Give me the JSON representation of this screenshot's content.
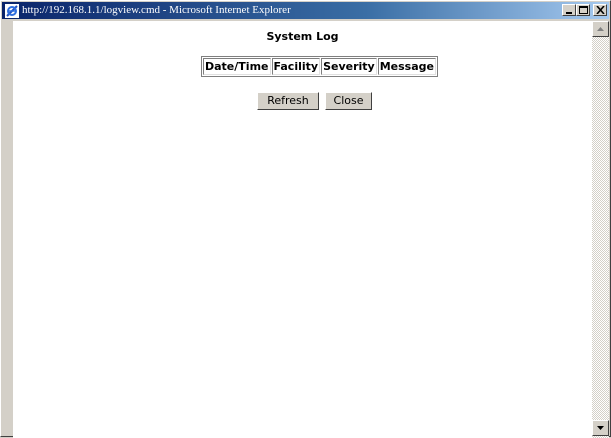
{
  "window": {
    "title": "http://192.168.1.1/logview.cmd - Microsoft Internet Explorer",
    "icon": "ie-icon",
    "controls": [
      "minimize-icon",
      "maximize-icon",
      "close-icon"
    ]
  },
  "page": {
    "title": "System Log",
    "table": {
      "headers": [
        "Date/Time",
        "Facility",
        "Severity",
        "Message"
      ],
      "rows": []
    },
    "buttons": {
      "refresh": "Refresh",
      "close": "Close"
    }
  },
  "colors": {
    "titlebar_start": "#0a246a",
    "titlebar_end": "#a6caf0",
    "chrome": "#d4d0c8",
    "content_bg": "#ffffff"
  }
}
